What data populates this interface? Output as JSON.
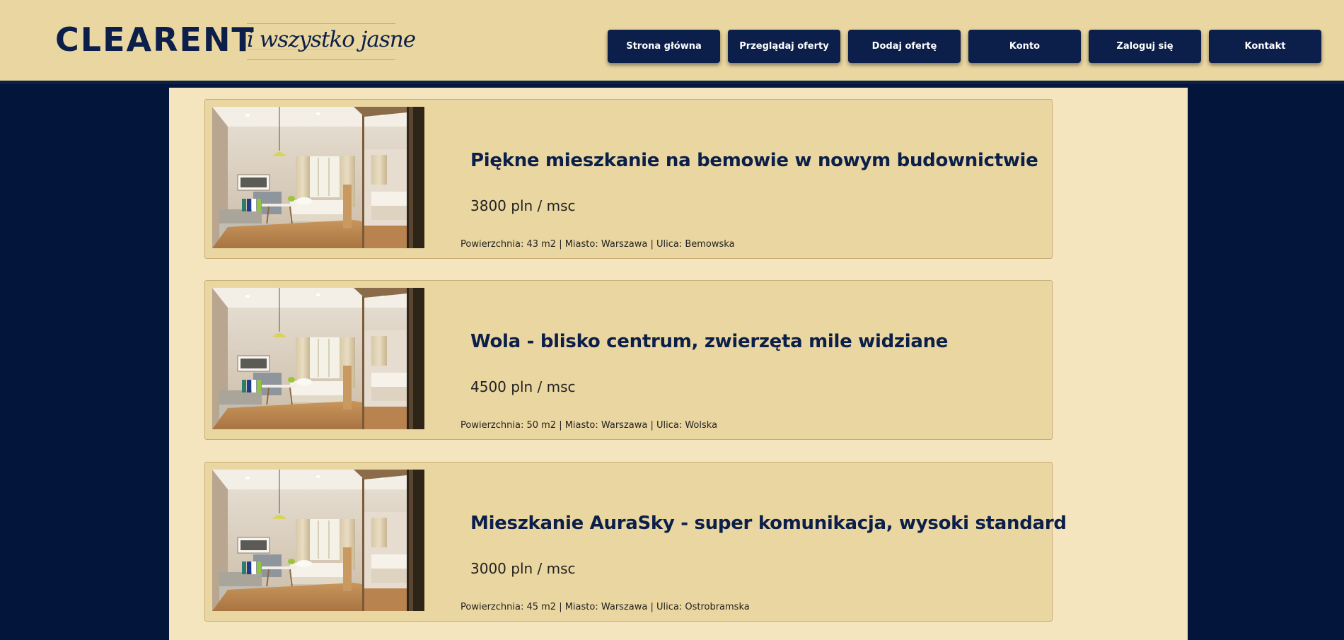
{
  "header": {
    "logo": "CLEARENT",
    "tagline": "i wszystko jasne",
    "nav": [
      "Strona główna",
      "Przeglądaj oferty",
      "Dodaj ofertę",
      "Konto",
      "Zaloguj się",
      "Kontakt"
    ]
  },
  "colors": {
    "navy": "#0b1f4a",
    "page_background": "#03153a",
    "header_background": "#ead6a0",
    "content_background": "#f5e5be",
    "card_background": "#ead6a0"
  },
  "listings": [
    {
      "title": "Piękne mieszkanie na bemowie w nowym budownictwie",
      "price": "3800 pln / msc",
      "details": "Powierzchnia: 43 m2 | Miasto: Warszawa | Ulica: Bemowska",
      "image_icon": "bedroom-photo-icon"
    },
    {
      "title": "Wola - blisko centrum, zwierzęta mile widziane",
      "price": "4500 pln / msc",
      "details": "Powierzchnia: 50 m2 | Miasto: Warszawa | Ulica: Wolska",
      "image_icon": "bedroom-photo-icon"
    },
    {
      "title": "Mieszkanie AuraSky - super komunikacja, wysoki standard",
      "price": "3000 pln / msc",
      "details": "Powierzchnia: 45 m2 | Miasto: Warszawa | Ulica: Ostrobramska",
      "image_icon": "bedroom-photo-icon"
    }
  ]
}
